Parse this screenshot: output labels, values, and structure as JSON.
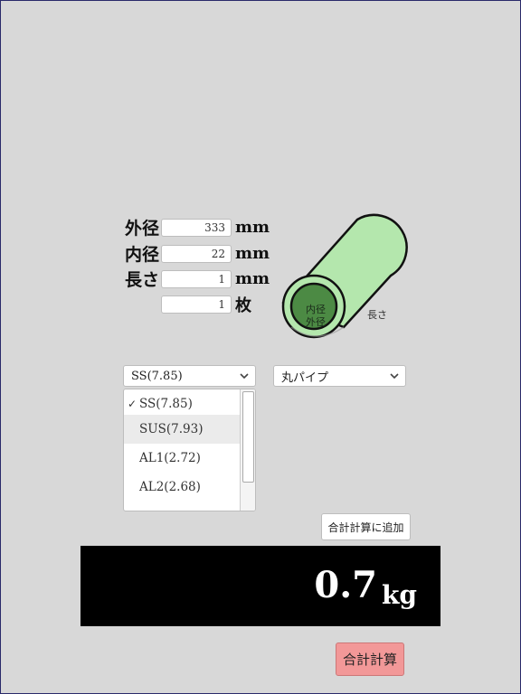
{
  "form": {
    "outer": {
      "label": "外径",
      "value": "333",
      "unit": "mm"
    },
    "inner": {
      "label": "内径",
      "value": "22",
      "unit": "mm"
    },
    "length": {
      "label": "長さ",
      "value": "1",
      "unit": "mm"
    },
    "count": {
      "label": "",
      "value": "1",
      "unit": "枚"
    }
  },
  "diagram": {
    "inner_label": "内径",
    "outer_label": "外径",
    "length_label": "長さ",
    "colors": {
      "light": "#b4e7ad",
      "dark": "#4c8a44"
    }
  },
  "material": {
    "selected": "SS(7.85)",
    "options": [
      "SS(7.85)",
      "SUS(7.93)",
      "AL1(2.72)",
      "AL2(2.68)"
    ],
    "checkmark": "✓"
  },
  "shape": {
    "selected": "丸パイプ"
  },
  "actions": {
    "add_label": "合計計算に追加",
    "total_label": "合計計算"
  },
  "result": {
    "value": "0.7",
    "unit": "kg"
  }
}
